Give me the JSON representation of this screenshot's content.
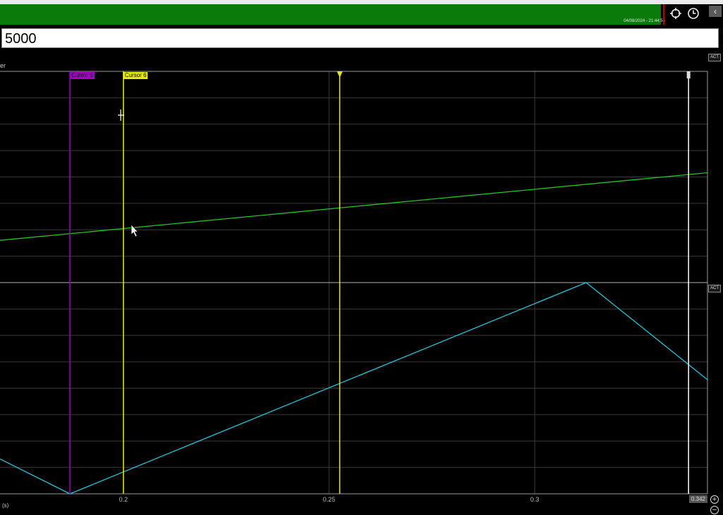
{
  "header": {
    "timestamp": "04/08/2024 - 21:44:54"
  },
  "value_input": {
    "value": "5000"
  },
  "plot": {
    "label": "er",
    "act_label": "ACT",
    "act_label_2": "ACT"
  },
  "cursors": [
    {
      "name": "Cursor 5",
      "color": "#a000c0",
      "time": 0.187
    },
    {
      "name": "Cursor 6",
      "color": "#e8e800",
      "time": 0.2
    }
  ],
  "trigger": {
    "color": "#e8e800",
    "time": 0.2526
  },
  "end_marker": {
    "color": "#ffffff",
    "time": 0.3374,
    "label": "0.342"
  },
  "x_axis": {
    "unit": "(s)",
    "ticks": [
      "0.2",
      "0.25",
      "0.3"
    ],
    "range": [
      0.17,
      0.342
    ]
  },
  "chart_data": [
    {
      "type": "line",
      "series": [
        {
          "color": "#22c322",
          "x": [
            0.17,
            0.342
          ],
          "y": [
            0.2,
            0.52
          ]
        }
      ],
      "ylim": [
        0,
        1
      ],
      "grid": true
    },
    {
      "type": "line",
      "series": [
        {
          "color": "#22c4d8",
          "x": [
            0.17,
            0.187,
            0.3125,
            0.342
          ],
          "y": [
            0.165,
            0,
            1,
            0.54
          ]
        }
      ],
      "ylim": [
        0,
        1
      ],
      "grid": true
    }
  ]
}
